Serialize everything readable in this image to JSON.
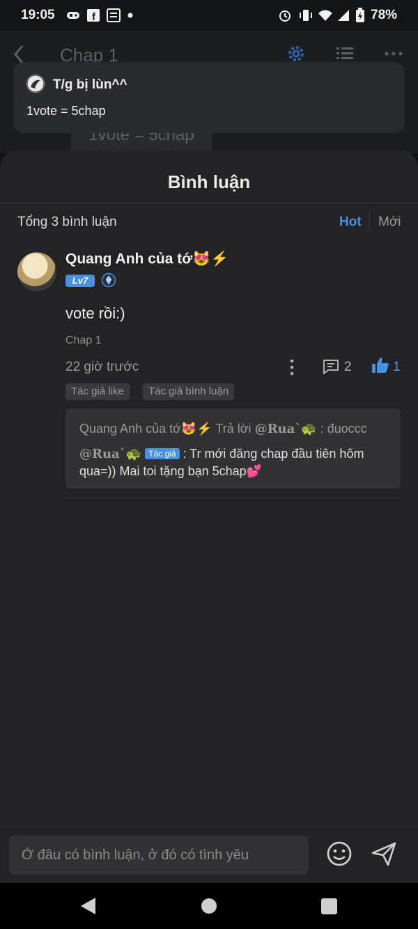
{
  "status_bar": {
    "time": "19:05",
    "battery_percent": "78%",
    "icons": [
      "gamepad-icon",
      "facebook-icon",
      "baomoi-icon",
      "dot-icon",
      "alarm-icon",
      "vibrate-icon",
      "wifi-icon",
      "signal-icon",
      "battery-icon"
    ]
  },
  "reader": {
    "title": "Chap 1",
    "ghost_text": "1vote = 5chap"
  },
  "notification": {
    "user": "T/g bị lùn^^",
    "text": "1vote = 5chap"
  },
  "comments_sheet": {
    "title": "Bình luận",
    "total": "Tổng 3 bình luận",
    "sort": {
      "hot": "Hot",
      "new": "Mới"
    },
    "comment": {
      "author": "Quang Anh của tớ😻⚡",
      "level": "Lv7",
      "text": "vote rồi:)",
      "chapter": "Chap 1",
      "time": "22 giờ trước",
      "reply_count": "2",
      "like_count": "1",
      "tags": [
        "Tác giả like",
        "Tác giả bình luận"
      ],
      "reply": {
        "line1_prefix": "Quang Anh của tớ😻⚡ Trả lời",
        "line1_mention": "@Rua`🐢",
        "line1_suffix": " : đuoccc",
        "author_nick": "@Rua`🐢",
        "author_tag": "Tác giả",
        "text": " : Tr mới đăng chap đầu tiên hôm qua=)) Mai toi tặng bạn 5chap💕"
      }
    }
  },
  "input_bar": {
    "placeholder": "Ở đâu có bình luận, ở đó có tình yêu"
  },
  "colors": {
    "accent": "#4a90e2",
    "sheet_bg": "#232325",
    "text": "#f0f0f0"
  }
}
